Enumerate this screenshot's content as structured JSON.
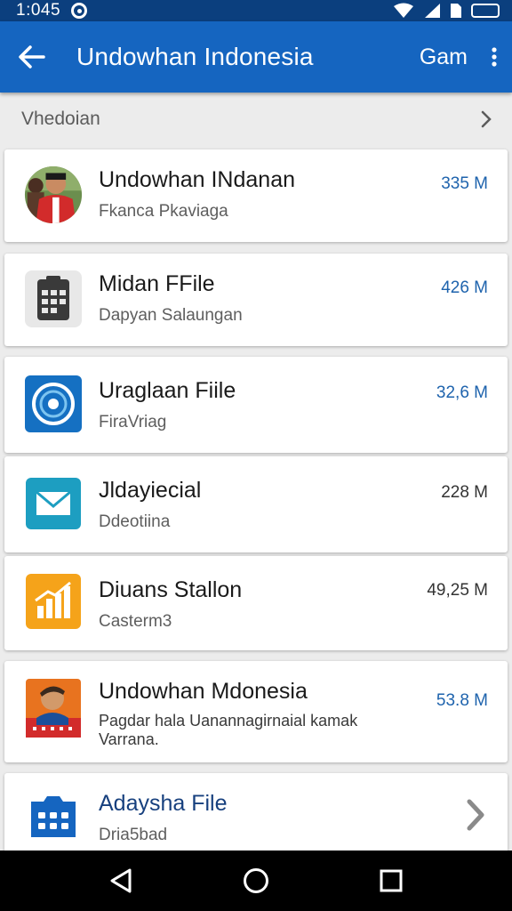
{
  "status_bar": {
    "time": "1:045",
    "battery": "□"
  },
  "app_bar": {
    "title": "Undowhan Indonesia",
    "action": "Gam"
  },
  "section": {
    "label": "Vhedoian"
  },
  "items": [
    {
      "title": "Undowhan INdanan",
      "subtitle": "Fkanca Pkaviaga",
      "size": "335 M",
      "icon": "profile-photo-icon"
    },
    {
      "title": "Midan FFile",
      "subtitle": "Dapyan Salaungan",
      "size": "426 M",
      "icon": "calendar-icon"
    },
    {
      "title": "Uraglaan Fiile",
      "subtitle": "FiraVriag",
      "size": "32,6 M",
      "icon": "target-icon"
    },
    {
      "title": "Jldayiecial",
      "subtitle": "Ddeotiina",
      "size": "228 M",
      "icon": "mail-icon"
    },
    {
      "title": "Diuans Stallon",
      "subtitle": "Casterm3",
      "size": "49,25 M",
      "icon": "bar-chart-icon"
    },
    {
      "title": "Undowhan Mdonesia",
      "subtitle": "Pagdar hala Uanannagirnaial kamak",
      "subtitle2": "Varrana.",
      "size": "53.8 M",
      "icon": "cartoon-avatar-icon"
    },
    {
      "title": "Adaysha File",
      "subtitle": "Dria5bad",
      "icon": "folder-apps-icon"
    }
  ],
  "colors": {
    "app_bar": "#1565c0",
    "status_bar": "#0b3f7e",
    "size_text": "#1e63ad",
    "nav_bar": "#000000"
  }
}
